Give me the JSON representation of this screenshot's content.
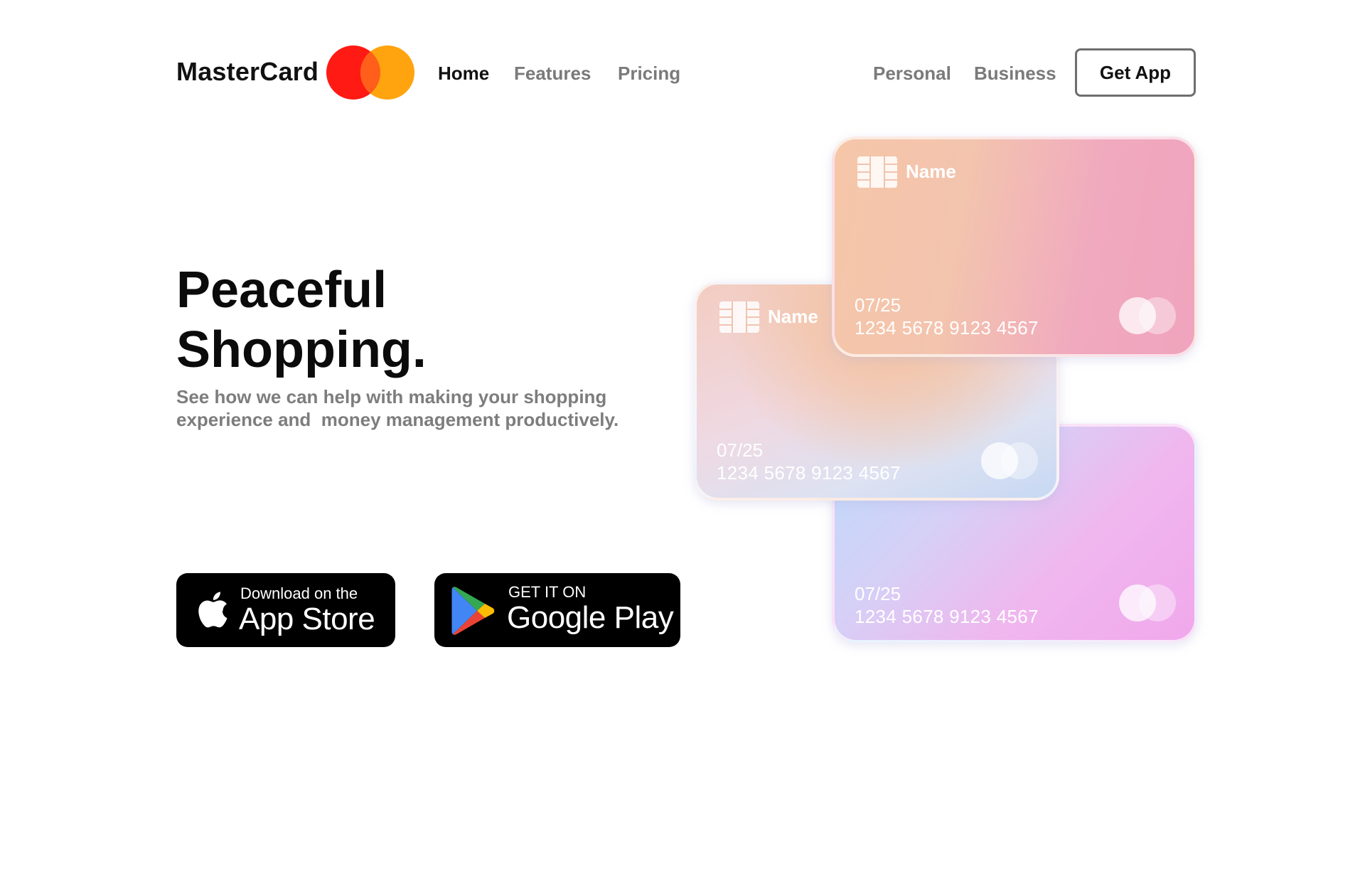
{
  "header": {
    "brand": "MasterCard",
    "nav_left": [
      "Home",
      "Features",
      "Pricing"
    ],
    "nav_right": [
      "Personal",
      "Business"
    ],
    "cta_label": "Get App",
    "logo_colors": {
      "left": "#ff1a14",
      "right": "#ffa40e",
      "overlap": "#ff5f1a"
    }
  },
  "hero": {
    "title_line1": "Peaceful",
    "title_line2": "Shopping.",
    "subtitle_line1": "See how we can help with making your shopping",
    "subtitle_line2": "experience and  money management productively."
  },
  "badges": {
    "apple": {
      "small": "Download on the",
      "big": "App Store"
    },
    "google": {
      "small": "GET IT ON",
      "big": "Google Play"
    }
  },
  "cards": {
    "front": {
      "name": "Name",
      "expiry": "07/25",
      "number": "1234 5678 9123 4567"
    },
    "middle": {
      "name": "Name",
      "expiry": "07/25",
      "number": "1234 5678 9123 4567"
    },
    "back": {
      "expiry": "07/25",
      "number": "1234 5678 9123 4567"
    }
  }
}
